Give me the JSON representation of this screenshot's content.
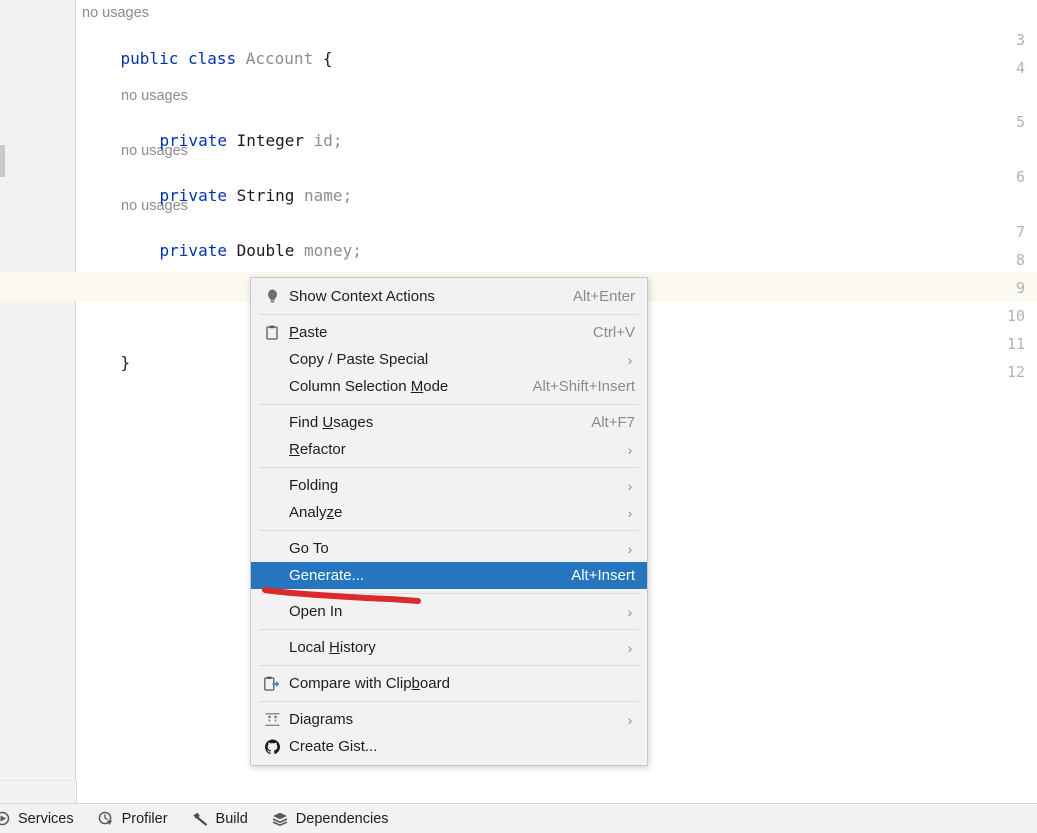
{
  "editor": {
    "gutter_lines": [
      "3",
      "4",
      "5",
      "6",
      "7",
      "8",
      "9",
      "10",
      "11",
      "12"
    ],
    "current_line": "9",
    "lines": [
      {
        "number": "",
        "hint": "no usages",
        "segments": []
      },
      {
        "number": "3",
        "hint": "",
        "segments": [
          {
            "text": "public ",
            "cls": "kw"
          },
          {
            "text": "class ",
            "cls": "kw"
          },
          {
            "text": "Account",
            "cls": "dim"
          },
          {
            "text": " {",
            "cls": "br"
          }
        ]
      },
      {
        "number": "4",
        "hint": "",
        "segments": []
      },
      {
        "number": "",
        "hint": "no usages",
        "segments": []
      },
      {
        "number": "5",
        "hint": "",
        "segments": [
          {
            "text": "private ",
            "cls": "kw"
          },
          {
            "text": "Integer ",
            "cls": "type"
          },
          {
            "text": "id;",
            "cls": "dim"
          }
        ]
      },
      {
        "number": "",
        "hint": "no usages",
        "segments": []
      },
      {
        "number": "6",
        "hint": "",
        "segments": [
          {
            "text": "private ",
            "cls": "kw"
          },
          {
            "text": "String ",
            "cls": "type"
          },
          {
            "text": "name;",
            "cls": "dim"
          }
        ]
      },
      {
        "number": "",
        "hint": "no usages",
        "segments": []
      },
      {
        "number": "7",
        "hint": "",
        "segments": [
          {
            "text": "private ",
            "cls": "kw"
          },
          {
            "text": "Double ",
            "cls": "type"
          },
          {
            "text": "money;",
            "cls": "dim"
          }
        ]
      },
      {
        "number": "8",
        "hint": "",
        "segments": []
      },
      {
        "number": "9",
        "hint": "",
        "segments": []
      },
      {
        "number": "10",
        "hint": "",
        "segments": []
      },
      {
        "number": "11",
        "hint": "",
        "segments": [
          {
            "text": "}",
            "cls": "br"
          }
        ]
      },
      {
        "number": "12",
        "hint": "",
        "segments": []
      }
    ],
    "code_text": {
      "hint_no_usages": "no usages",
      "l3": "public class Account {",
      "l5": "private Integer id;",
      "l6": "private String name;",
      "l7": "private Double money;",
      "l11": "}"
    }
  },
  "context_menu": {
    "selected_item": "Generate...",
    "groups": [
      {
        "items": [
          {
            "label": "Show Context Actions",
            "mnemonic": "",
            "shortcut": "Alt+Enter",
            "icon": "lightbulb-icon",
            "submenu": false,
            "selected": false
          }
        ]
      },
      {
        "items": [
          {
            "label": "Paste",
            "mnemonic": "P",
            "shortcut": "Ctrl+V",
            "icon": "clipboard-icon",
            "submenu": false,
            "selected": false
          },
          {
            "label": "Copy / Paste Special",
            "mnemonic": "",
            "shortcut": "",
            "icon": "",
            "submenu": true,
            "selected": false
          },
          {
            "label": "Column Selection Mode",
            "mnemonic": "M",
            "shortcut": "Alt+Shift+Insert",
            "icon": "",
            "submenu": false,
            "selected": false
          }
        ]
      },
      {
        "items": [
          {
            "label": "Find Usages",
            "mnemonic": "U",
            "shortcut": "Alt+F7",
            "icon": "",
            "submenu": false,
            "selected": false
          },
          {
            "label": "Refactor",
            "mnemonic": "R",
            "shortcut": "",
            "icon": "",
            "submenu": true,
            "selected": false
          }
        ]
      },
      {
        "items": [
          {
            "label": "Folding",
            "mnemonic": "g",
            "shortcut": "",
            "icon": "",
            "submenu": true,
            "selected": false
          },
          {
            "label": "Analyze",
            "mnemonic": "z",
            "shortcut": "",
            "icon": "",
            "submenu": true,
            "selected": false
          }
        ]
      },
      {
        "items": [
          {
            "label": "Go To",
            "mnemonic": "",
            "shortcut": "",
            "icon": "",
            "submenu": true,
            "selected": false
          },
          {
            "label": "Generate...",
            "mnemonic": "",
            "shortcut": "Alt+Insert",
            "icon": "",
            "submenu": false,
            "selected": true
          }
        ]
      },
      {
        "items": [
          {
            "label": "Open In",
            "mnemonic": "",
            "shortcut": "",
            "icon": "",
            "submenu": true,
            "selected": false
          }
        ]
      },
      {
        "items": [
          {
            "label": "Local History",
            "mnemonic": "H",
            "shortcut": "",
            "icon": "",
            "submenu": true,
            "selected": false
          }
        ]
      },
      {
        "items": [
          {
            "label": "Compare with Clipboard",
            "mnemonic": "b",
            "shortcut": "",
            "icon": "compare-clipboard-icon",
            "submenu": false,
            "selected": false
          }
        ]
      },
      {
        "items": [
          {
            "label": "Diagrams",
            "mnemonic": "",
            "shortcut": "",
            "icon": "diagrams-icon",
            "submenu": true,
            "selected": false
          },
          {
            "label": "Create Gist...",
            "mnemonic": "",
            "shortcut": "",
            "icon": "github-icon",
            "submenu": false,
            "selected": false
          }
        ]
      }
    ]
  },
  "annotation": {
    "type": "hand-drawn-underline",
    "color": "#d92b2b",
    "target": "Generate..."
  },
  "status_bar": {
    "items": [
      {
        "label": "Services",
        "icon": "services-icon"
      },
      {
        "label": "Profiler",
        "icon": "profiler-icon"
      },
      {
        "label": "Build",
        "icon": "hammer-icon"
      },
      {
        "label": "Dependencies",
        "icon": "layers-icon"
      }
    ]
  },
  "colors": {
    "keyword": "#0033B3",
    "dim_text": "#8C8C8C",
    "selection": "#2675BF",
    "current_line": "#FBF8EF",
    "gutter": "#F2F2F2",
    "annotation_red": "#D92B2B"
  }
}
